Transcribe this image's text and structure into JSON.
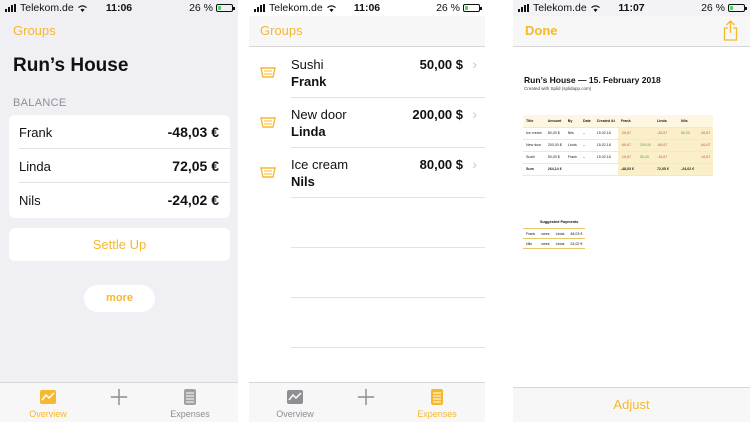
{
  "colors": {
    "accent": "#f5b82e",
    "battery": "#4cd964",
    "negative": "#d9534f",
    "positive": "#58a34a"
  },
  "screens": [
    {
      "status": {
        "carrier": "Telekom.de",
        "time": "11:06",
        "battery": "26 %",
        "battery_level": 0.26
      },
      "nav": {
        "back": "Groups"
      },
      "group_name": "Run’s House",
      "balance": {
        "header": "BALANCE",
        "rows": [
          {
            "name": "Frank",
            "value": "-48,03 €"
          },
          {
            "name": "Linda",
            "value": "72,05 €"
          },
          {
            "name": "Nils",
            "value": "-24,02 €"
          }
        ]
      },
      "settle_label": "Settle Up",
      "more_label": "more",
      "tabs": [
        {
          "label": "Overview",
          "icon": "chart-icon"
        },
        {
          "label": "",
          "icon": "plus-icon"
        },
        {
          "label": "Expenses",
          "icon": "expenses-icon"
        }
      ],
      "active_tab": "Overview"
    },
    {
      "status": {
        "carrier": "Telekom.de",
        "time": "11:06",
        "battery": "26 %",
        "battery_level": 0.26
      },
      "nav": {
        "back": "Groups"
      },
      "expenses": [
        {
          "title": "Sushi",
          "payer": "Frank",
          "amount": "50,00 $",
          "icon": "basket-icon"
        },
        {
          "title": "New door",
          "payer": "Linda",
          "amount": "200,00 $",
          "icon": "basket-icon"
        },
        {
          "title": "Ice cream",
          "payer": "Nils",
          "amount": "80,00 $",
          "icon": "basket-icon"
        }
      ],
      "tabs": [
        {
          "label": "Overview",
          "icon": "chart-icon"
        },
        {
          "label": "",
          "icon": "plus-icon"
        },
        {
          "label": "Expenses",
          "icon": "expenses-icon"
        }
      ],
      "active_tab": "Expenses"
    },
    {
      "status": {
        "carrier": "Telekom.de",
        "time": "11:07",
        "battery": "26 %",
        "battery_level": 0.26
      },
      "nav": {
        "done": "Done",
        "share_icon": "share-icon"
      },
      "report": {
        "title": "Run’s House — 15. February 2018",
        "subtitle": "Created with Splid (splidapp.com)",
        "columns": [
          "Title",
          "Amount",
          "By",
          "Date",
          "Created At",
          "Frank",
          "",
          "Linda",
          "",
          "Nils",
          ""
        ],
        "rows": [
          [
            "Ice cream",
            "80,00 $",
            "Nils",
            "–",
            "15.02.18",
            "-26,67",
            "",
            "-26,67",
            "",
            "80,00",
            "-26,67"
          ],
          [
            "New door",
            "200,00 $",
            "Linda",
            "–",
            "15.02.18",
            "-66,67",
            "200,00",
            "-66,67",
            "",
            "",
            "-66,67"
          ],
          [
            "Sushi",
            "50,00 $",
            "Frank",
            "–",
            "15.02.18",
            "-16,67",
            "50,00",
            "-16,67",
            "",
            "",
            "-16,67"
          ]
        ],
        "sum_row": [
          "Sum",
          "264,14 €",
          "",
          "",
          "",
          "-48,03 €",
          "",
          "72,05 €",
          "",
          "-24,02 €",
          ""
        ],
        "suggested_title": "Suggested Payments",
        "suggested": [
          {
            "from": "Frank",
            "verb": "owes",
            "to": "Linda",
            "amount": "48,03 €"
          },
          {
            "from": "Nils",
            "verb": "owes",
            "to": "Linda",
            "amount": "24,02 €"
          }
        ]
      },
      "adjust_label": "Adjust"
    }
  ]
}
